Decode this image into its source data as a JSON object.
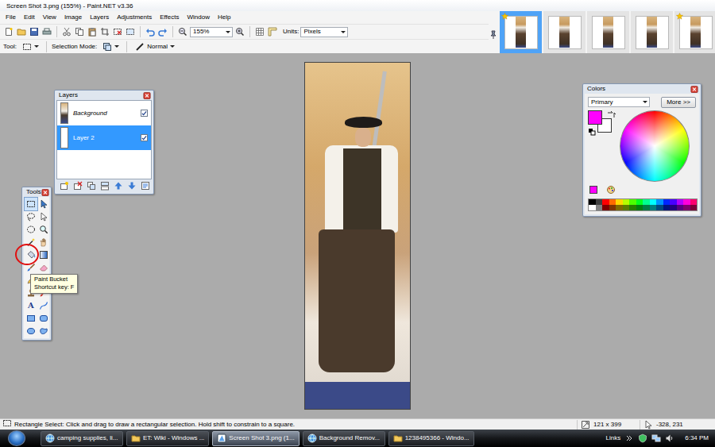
{
  "window": {
    "title": "Screen Shot 3.png (155%) - Paint.NET v3.36"
  },
  "menu": [
    "File",
    "Edit",
    "View",
    "Image",
    "Layers",
    "Adjustments",
    "Effects",
    "Window",
    "Help"
  ],
  "toolbar": {
    "zoom": "155%",
    "units_label": "Units:",
    "units": "Pixels"
  },
  "tool_options": {
    "tool_label": "Tool:",
    "selection_mode_label": "Selection Mode:",
    "blend_mode": "Normal"
  },
  "documents": [
    {
      "selected": true,
      "modified": true
    },
    {
      "selected": false,
      "modified": false
    },
    {
      "selected": false,
      "modified": false
    },
    {
      "selected": false,
      "modified": false
    },
    {
      "selected": false,
      "modified": true
    }
  ],
  "layers": {
    "title": "Layers",
    "items": [
      {
        "name": "Background",
        "visible": true,
        "selected": false
      },
      {
        "name": "Layer 2",
        "visible": true,
        "selected": true
      }
    ]
  },
  "tools": {
    "title": "Tools",
    "items": [
      {
        "selected": true,
        "circled": false
      },
      {
        "selected": false,
        "circled": false
      },
      {
        "selected": false,
        "circled": false
      },
      {
        "selected": false,
        "circled": false
      },
      {
        "selected": false,
        "circled": false
      },
      {
        "selected": false,
        "circled": false
      },
      {
        "selected": false,
        "circled": false
      },
      {
        "selected": false,
        "circled": false
      },
      {
        "selected": false,
        "circled": true
      },
      {
        "selected": false,
        "circled": false
      },
      {
        "selected": false,
        "circled": false
      },
      {
        "selected": false,
        "circled": false
      },
      {
        "selected": false,
        "circled": false
      },
      {
        "selected": false,
        "circled": false
      },
      {
        "selected": false,
        "circled": false
      },
      {
        "selected": false,
        "circled": false
      },
      {
        "selected": false,
        "circled": false,
        "glyph": "A"
      },
      {
        "selected": false,
        "circled": false
      },
      {
        "selected": false,
        "circled": false
      },
      {
        "selected": false,
        "circled": false
      },
      {
        "selected": false,
        "circled": false
      },
      {
        "selected": false,
        "circled": false
      }
    ],
    "tooltip": {
      "title": "Paint Bucket",
      "shortcut": "Shortcut key: F"
    }
  },
  "colors": {
    "title": "Colors",
    "mode": "Primary",
    "more": "More >>",
    "primary": "#ff00ff",
    "secondary": "#ffffff",
    "palette": [
      "#000000",
      "#404040",
      "#ff0000",
      "#ff6a00",
      "#ffd800",
      "#b6ff00",
      "#4cff00",
      "#00ff21",
      "#00ff90",
      "#00ffff",
      "#0094ff",
      "#0026ff",
      "#4800ff",
      "#b200ff",
      "#ff00dc",
      "#ff006e",
      "#ffffff",
      "#808080",
      "#7f0000",
      "#7f3300",
      "#7f6a00",
      "#5b7f00",
      "#267f00",
      "#007f0e",
      "#007f46",
      "#007f7f",
      "#004a7f",
      "#00137f",
      "#21007f",
      "#57007f",
      "#7f006e",
      "#7f0037"
    ]
  },
  "status_bar": {
    "text": "Rectangle Select: Click and drag to draw a rectangular selection. Hold shift to constrain to a square.",
    "size": "121 x 399",
    "cursor": "-328, 231"
  },
  "taskbar": {
    "tasks": [
      {
        "label": "camping supplies, li...",
        "selected": false
      },
      {
        "label": "ET: Wiki - Windows ...",
        "selected": false
      },
      {
        "label": "Screen Shot 3.png (1...",
        "selected": true
      },
      {
        "label": "Background Remov...",
        "selected": false
      },
      {
        "label": "1238495366 - Windo...",
        "selected": false
      }
    ],
    "links": "Links",
    "clock": "6:34 PM"
  }
}
